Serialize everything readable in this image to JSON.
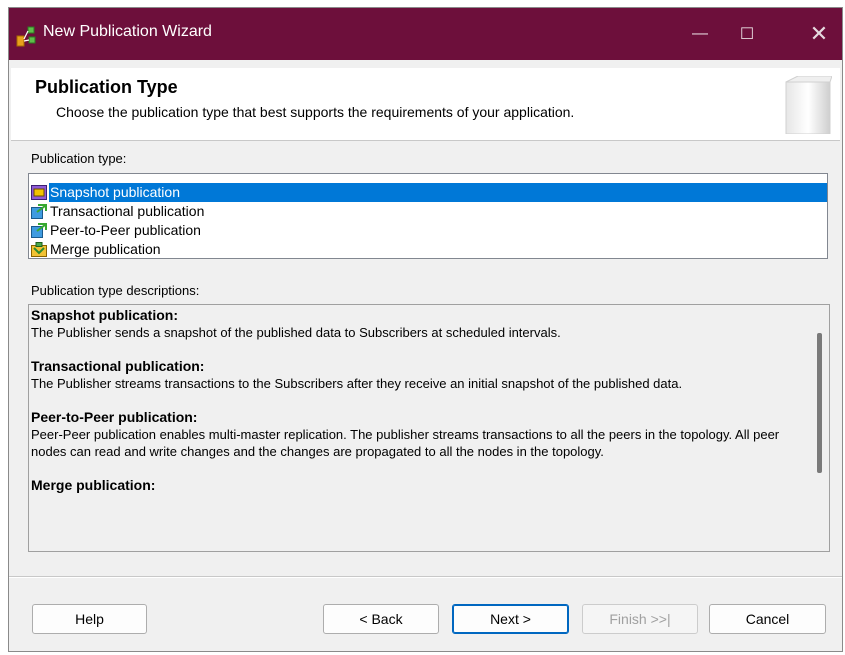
{
  "window": {
    "title": "New Publication Wizard",
    "minimize_glyph": "—",
    "maximize_glyph": "☐",
    "close_glyph": "✕",
    "titlebar_color": "#6d0f3b"
  },
  "header": {
    "title": "Publication Type",
    "subtitle": "Choose the publication type that best supports the requirements of your application."
  },
  "publication_type": {
    "label": "Publication type:",
    "items": [
      {
        "label": "Snapshot publication",
        "icon": "snapshot-publication-icon",
        "selected": true
      },
      {
        "label": "Transactional publication",
        "icon": "transactional-publication-icon",
        "selected": false
      },
      {
        "label": "Peer-to-Peer publication",
        "icon": "peer-to-peer-publication-icon",
        "selected": false
      },
      {
        "label": "Merge publication",
        "icon": "merge-publication-icon",
        "selected": false
      }
    ],
    "selection_color": "#0078d7"
  },
  "descriptions": {
    "label": "Publication type descriptions:",
    "entries": [
      {
        "heading": "Snapshot publication:",
        "text": "The Publisher sends a snapshot of the published data to Subscribers at scheduled intervals."
      },
      {
        "heading": "Transactional publication:",
        "text": "The Publisher streams transactions to the Subscribers after they receive an initial snapshot of the published data."
      },
      {
        "heading": "Peer-to-Peer publication:",
        "text": "Peer-Peer publication enables multi-master replication. The publisher streams transactions to all the peers in the topology. All peer nodes can read and write changes and the changes are propagated to all the nodes in the topology."
      },
      {
        "heading": "Merge publication:",
        "text": ""
      }
    ]
  },
  "buttons": {
    "help": "Help",
    "back": "< Back",
    "next": "Next >",
    "finish": "Finish >>|",
    "cancel": "Cancel"
  }
}
